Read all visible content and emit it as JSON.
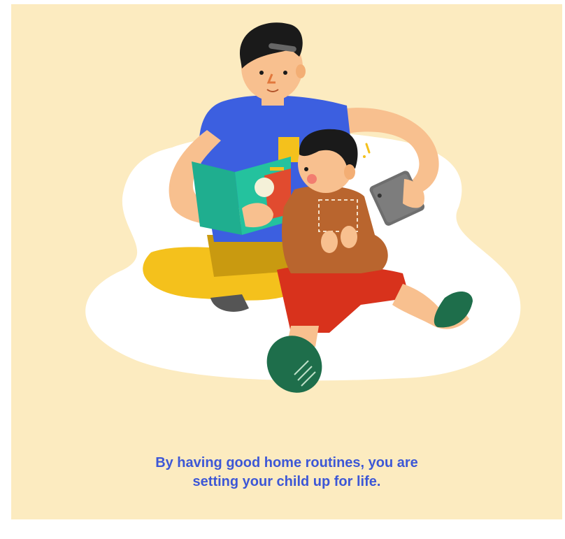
{
  "caption": {
    "line1": "By having good home routines, you are",
    "line2": "setting your child up for life."
  },
  "colors": {
    "background": "#fcebc0",
    "caption_text": "#3d57d6",
    "blob": "#ffffff",
    "dad_shirt": "#3c5fe0",
    "dad_pants": "#f4c11c",
    "book": "#1fae8f",
    "kid_shirt": "#b9652e",
    "kid_shorts": "#d8321c",
    "kid_shoes": "#1e6e4b",
    "phone": "#6e6e6e",
    "skin": "#f8c08f",
    "hair": "#1a1a1a"
  }
}
